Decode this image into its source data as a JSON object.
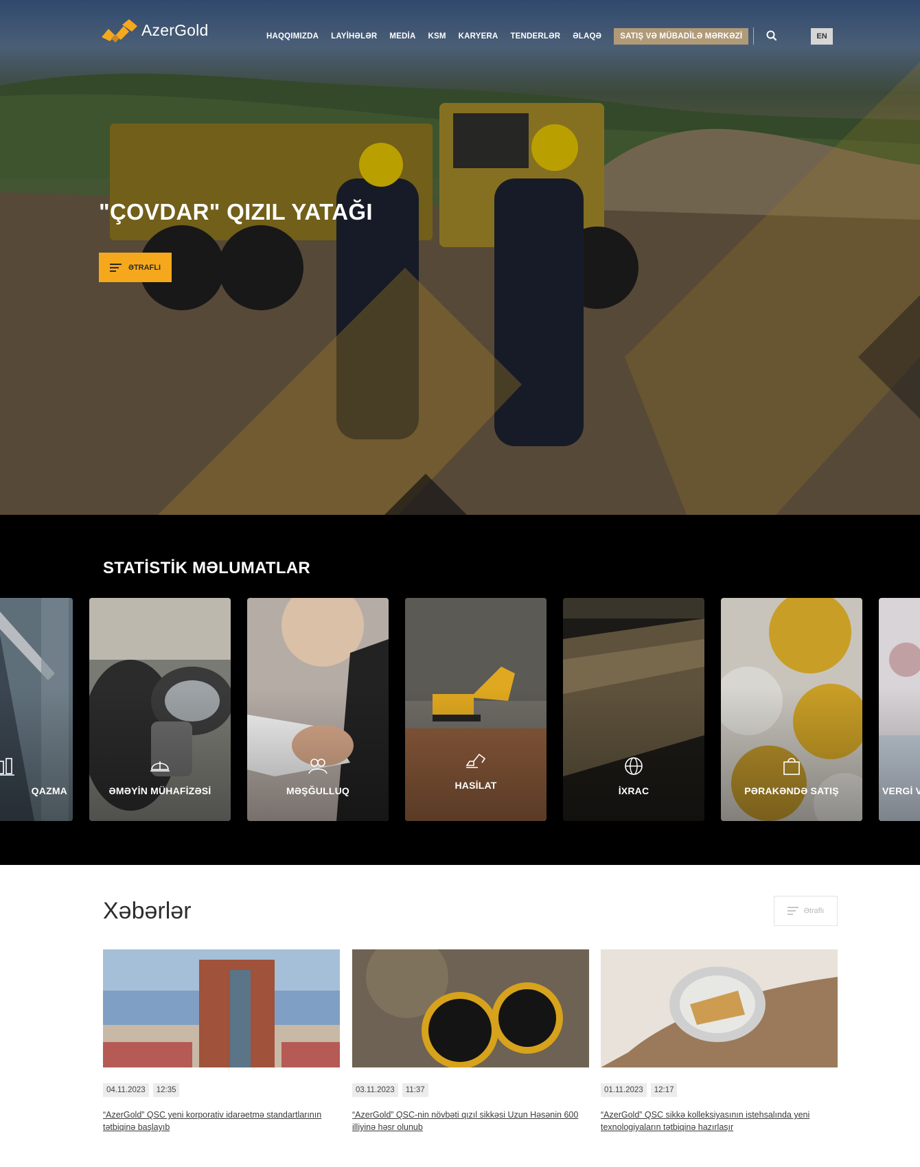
{
  "brand": {
    "name": "AzerGold",
    "accent": "#f6a81c"
  },
  "nav": {
    "items": [
      "HAQQIMIZDA",
      "LAYİHƏLƏR",
      "MEDİA",
      "KSM",
      "KARYERA",
      "TENDERLƏR",
      "ƏLAQƏ"
    ],
    "cta": "SATIŞ VƏ MÜBADİLƏ MƏRKƏZİ",
    "search_icon": "search-icon",
    "lang": "EN"
  },
  "hero": {
    "title": "\"ÇOVDAR\" QIZIL YATAĞI",
    "button": "ƏTRAFLI"
  },
  "stats": {
    "title": "STATİSTİK MƏLUMATLAR",
    "cards": [
      {
        "label": "QAZMA",
        "icon": "drill-icon"
      },
      {
        "label": "ƏMƏYİN MÜHAFİZƏSİ",
        "icon": "helmet-icon"
      },
      {
        "label": "MƏŞĞULLUQ",
        "icon": "people-icon"
      },
      {
        "label": "HASİLAT",
        "icon": "excavator-icon"
      },
      {
        "label": "İXRAC",
        "icon": "globe-icon"
      },
      {
        "label": "PƏRAKƏNDƏ SATIŞ",
        "icon": "shopping-bag-icon"
      },
      {
        "label": "VERGİ V",
        "icon": ""
      }
    ]
  },
  "news": {
    "title": "Xəbərlər",
    "more": "Ətraflı",
    "items": [
      {
        "date": "04.11.2023",
        "time": "12:35",
        "title": "“AzerGold” QSC yeni korporativ idarəetmə standartlarının tətbiqinə başlayıb"
      },
      {
        "date": "03.11.2023",
        "time": "11:37",
        "title": "“AzerGold” QSC-nin növbəti qızıl sikkəsi Uzun Həsənin 600 illiyinə həsr olunub"
      },
      {
        "date": "01.11.2023",
        "time": "12:17",
        "title": "“AzerGold” QSC sikkə kolleksiyasının istehsalında yeni texnologiyaların tətbiqinə hazırlaşır"
      }
    ]
  }
}
